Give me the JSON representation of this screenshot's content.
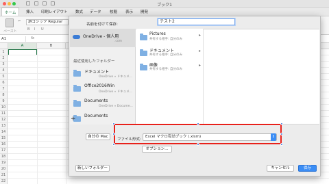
{
  "window": {
    "title": "ブック1"
  },
  "ribbon": {
    "tabs": [
      "ホーム",
      "挿入",
      "印刷レイアウト",
      "数式",
      "データ",
      "校閲",
      "表示",
      "開発"
    ],
    "active_tab": "ホーム",
    "paste_label": "ペースト",
    "font_name": "游ゴシック Regular"
  },
  "formula_bar": {
    "name_box": "A1",
    "fx": "fx"
  },
  "sheet": {
    "columns": [
      "A",
      "B"
    ],
    "rows": [
      "1",
      "2",
      "3",
      "4",
      "5",
      "6",
      "7",
      "8",
      "9",
      "10",
      "11",
      "12",
      "13",
      "14",
      "15",
      "16",
      "17",
      "18",
      "19",
      "20",
      "21",
      "22"
    ]
  },
  "dialog": {
    "save_as_label": "名前を付けて保存:",
    "filename": "テスト2",
    "sidebar": {
      "onedrive_title": "OneDrive - 個人用",
      "onedrive_sub": ".com",
      "recent_header": "最近使用したフォルダー",
      "recent": [
        {
          "name": "ドキュメント",
          "path": "OneDrive » ドキュメ..."
        },
        {
          "name": "Office2016Win",
          "path": "OneDrive » ドキュメ..."
        },
        {
          "name": "Documents",
          "path": "OneDrive » Docume..."
        },
        {
          "name": "Documents",
          "path": ""
        }
      ]
    },
    "folders": [
      {
        "name": "Pictures",
        "sub": "共有する相手: 自分のみ"
      },
      {
        "name": "ドキュメント",
        "sub": "共有する相手: 自分のみ"
      },
      {
        "name": "画像",
        "sub": "共有する相手: 自分のみ"
      }
    ],
    "on_my_mac_button": "自分の Mac",
    "file_format_label": "ファイル形式:",
    "file_format_value": "Excel マクロ有効ブック (.xlsm)",
    "options_button": "オプション...",
    "new_folder_button": "新しいフォルダー",
    "cancel_button": "キャンセル",
    "save_button": "保存"
  },
  "colors": {
    "accent_blue": "#3b8df5",
    "excel_green": "#1f7244",
    "annotation_red": "#e8211b"
  }
}
